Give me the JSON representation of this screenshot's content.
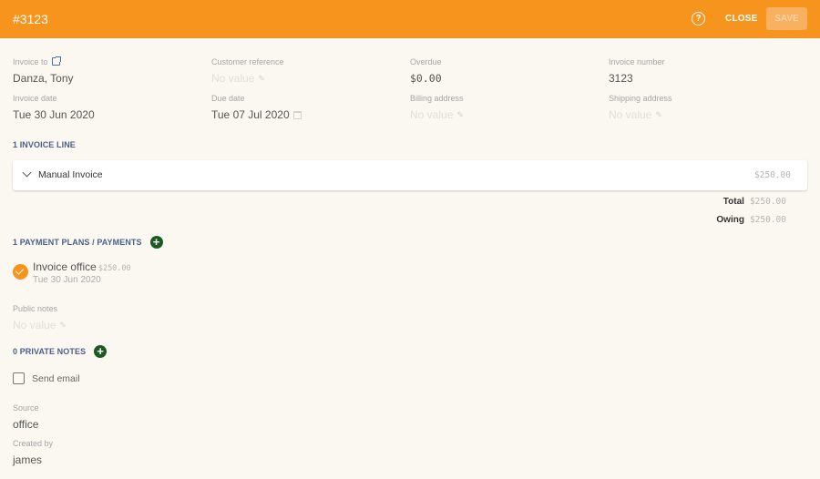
{
  "header": {
    "title": "#3123",
    "help_icon": "?",
    "close_label": "CLOSE",
    "save_label": "SAVE"
  },
  "fields": {
    "invoice_to": {
      "label": "Invoice to",
      "value": "Danza, Tony"
    },
    "customer_reference": {
      "label": "Customer reference",
      "value": "No value"
    },
    "overdue": {
      "label": "Overdue",
      "value": "$0.00"
    },
    "invoice_number": {
      "label": "Invoice number",
      "value": "3123"
    },
    "invoice_date": {
      "label": "Invoice date",
      "value": "Tue 30 Jun 2020"
    },
    "due_date": {
      "label": "Due date",
      "value": "Tue 07 Jul 2020"
    },
    "billing_address": {
      "label": "Billing address",
      "value": "No value"
    },
    "shipping_address": {
      "label": "Shipping address",
      "value": "No value"
    }
  },
  "invoice_lines": {
    "title": "1 INVOICE LINE",
    "items": [
      {
        "name": "Manual Invoice",
        "amount": "$250.00"
      }
    ],
    "total_label": "Total",
    "total_value": "$250.00",
    "owing_label": "Owing",
    "owing_value": "$250.00"
  },
  "payments": {
    "title": "1 PAYMENT PLANS / PAYMENTS",
    "items": [
      {
        "title": "Invoice office",
        "amount": "$250.00",
        "date": "Tue 30 Jun 2020",
        "status": "paid"
      }
    ]
  },
  "public_notes": {
    "label": "Public notes",
    "value": "No value"
  },
  "private_notes": {
    "title": "0 PRIVATE NOTES"
  },
  "send_email": {
    "label": "Send email",
    "checked": false
  },
  "source": {
    "label": "Source",
    "value": "office"
  },
  "created_by": {
    "label": "Created by",
    "value": "james"
  },
  "colors": {
    "header_bg": "#f7941e",
    "section_title": "#4b5f8a",
    "add_button": "#1c5a24",
    "background": "#fbf8f1"
  }
}
